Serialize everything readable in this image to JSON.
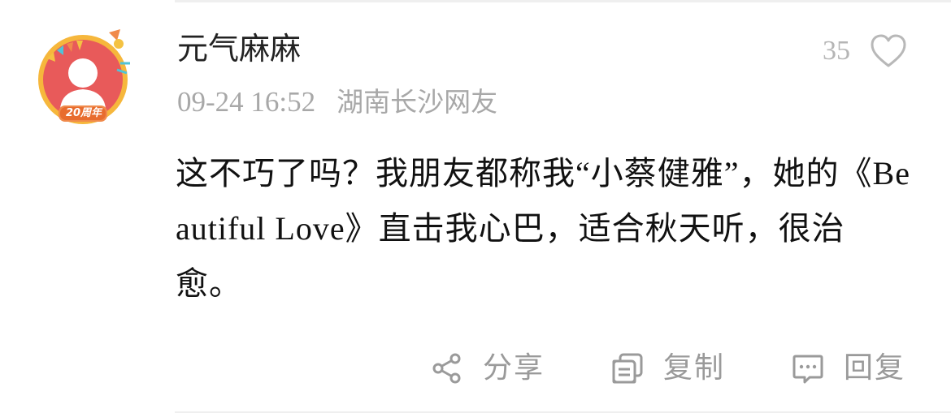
{
  "comment": {
    "username": "元气麻麻",
    "avatar_badge": "20周年",
    "time": "09-24 16:52",
    "location": "湖南长沙网友",
    "likes": "35",
    "text_parts": [
      "这不巧了吗？我朋友都称我",
      "“小蔡健雅”",
      "，她的《",
      "Beautiful Love",
      "》直击我心巴，适合秋天听，很治愈。"
    ]
  },
  "actions": {
    "share_label": "分享",
    "copy_label": "复制",
    "reply_label": "回复"
  },
  "colors": {
    "avatar_ring": "#f6b73c",
    "avatar_bg": "#e85a5a",
    "muted_text": "#a8a8a8",
    "body_text": "#111111"
  }
}
